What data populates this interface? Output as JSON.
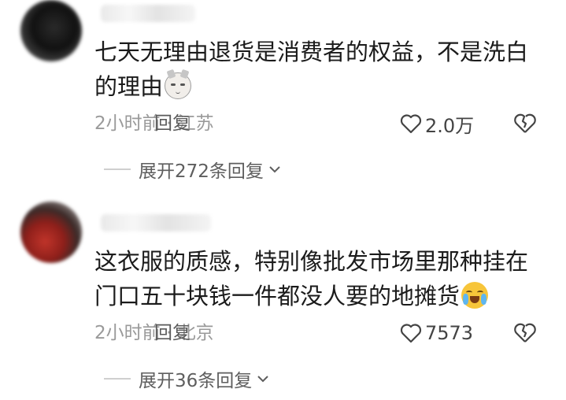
{
  "comments": [
    {
      "text": "七天无理由退货是消费者的权益，不是洗白的理由",
      "emoji": "cat-face-icon",
      "time_location": "2小时前 · 江苏",
      "reply_label": "回复",
      "likes": "2.0万",
      "expand_label": "展开272条回复"
    },
    {
      "text": "这衣服的质感，特别像批发市场里那种挂在门口五十块钱一件都没人要的地摊货",
      "emoji": "crying-laughing-icon",
      "time_location": "2小时前 · 北京",
      "reply_label": "回复",
      "likes": "7573",
      "expand_label": "展开36条回复"
    }
  ],
  "colors": {
    "text": "#1b1b1b",
    "meta": "#9a9a9a",
    "icon": "#444444"
  }
}
